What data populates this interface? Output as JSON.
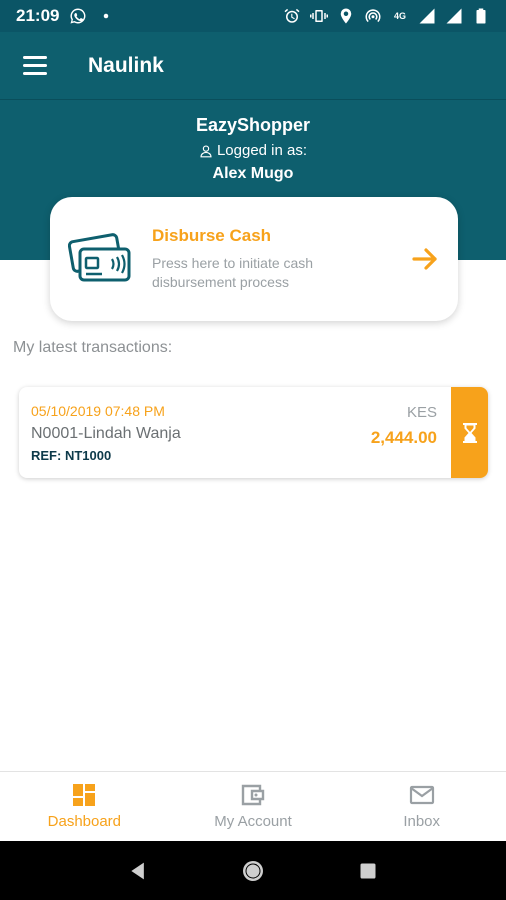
{
  "status_bar": {
    "time": "21:09",
    "net_label": "4G",
    "icons": [
      "whatsapp-icon",
      "dot-icon",
      "alarm-icon",
      "vibrate-icon",
      "location-icon",
      "hotspot-icon",
      "signal-icon",
      "signal-icon",
      "battery-icon"
    ]
  },
  "app_bar": {
    "title": "Naulink",
    "menu_icon": "menu-icon"
  },
  "profile": {
    "store_name": "EazyShopper",
    "logged_in_label": "Logged in as:",
    "user_name": "Alex Mugo"
  },
  "disburse": {
    "title": "Disburse Cash",
    "subtitle": "Press here to initiate cash disbursement process",
    "icon": "cards-icon",
    "arrow_icon": "arrow-right-icon"
  },
  "transactions": {
    "section_label": "My latest transactions:",
    "items": [
      {
        "date": "05/10/2019 07:48 PM",
        "name": "N0001-Lindah Wanja",
        "ref": "REF: NT1000",
        "currency": "KES",
        "amount": "2,444.00",
        "status_icon": "hourglass-icon"
      }
    ]
  },
  "bottom_nav": {
    "items": [
      {
        "label": "Dashboard",
        "icon": "dashboard-icon",
        "active": true
      },
      {
        "label": "My Account",
        "icon": "wallet-icon",
        "active": false
      },
      {
        "label": "Inbox",
        "icon": "mail-icon",
        "active": false
      }
    ]
  },
  "colors": {
    "primary": "#0e5f6e",
    "accent": "#f7a21b",
    "muted_text": "#9aa0a4",
    "dark_text": "#0e3a4a"
  }
}
